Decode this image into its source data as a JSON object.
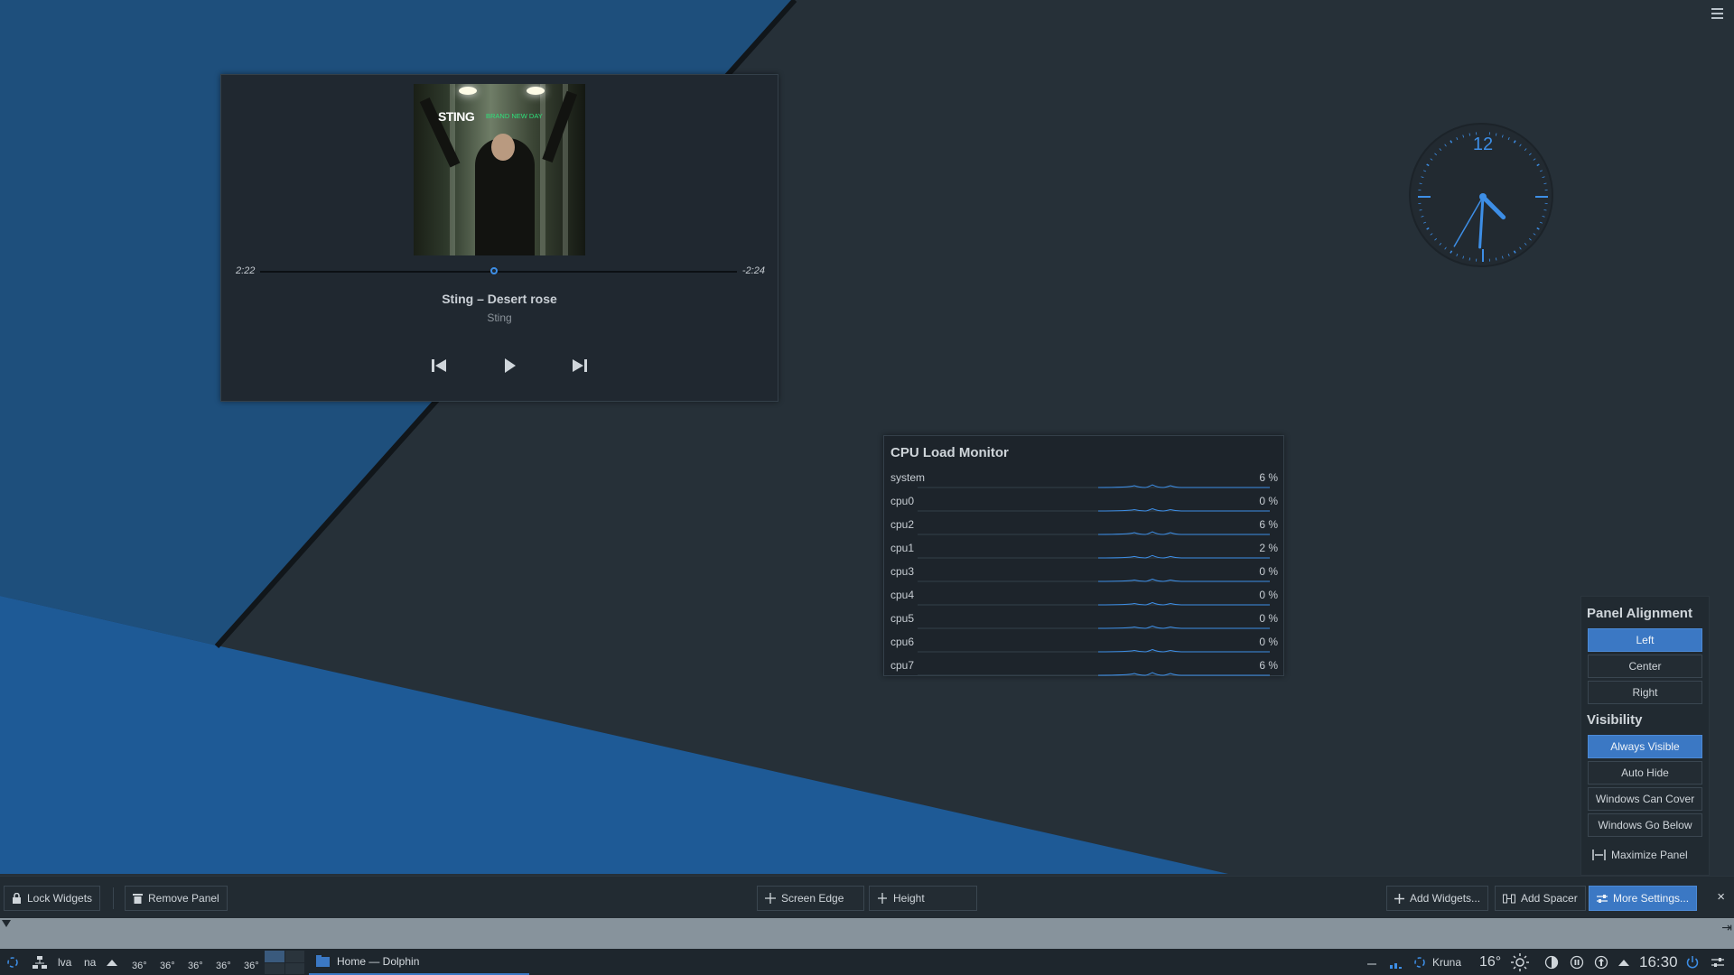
{
  "desktop": {
    "menu_icon": "hamburger-icon"
  },
  "media_player": {
    "album_cover": {
      "title_artist": "STING",
      "title_album": "BRAND NEW DAY"
    },
    "time_elapsed": "2:22",
    "time_remaining": "-2:24",
    "progress": 0.49,
    "track_title": "Sting – Desert rose",
    "track_artist": "Sting",
    "controls": {
      "previous": "skip-previous-icon",
      "play": "play-icon",
      "next": "skip-next-icon"
    }
  },
  "clock": {
    "label_12": "12",
    "hour": 4,
    "minute": 30,
    "second": 35,
    "accent_color": "#3d8ee6"
  },
  "cpu_monitor": {
    "title": "CPU Load Monitor",
    "rows": [
      {
        "name": "system",
        "value": "6 %"
      },
      {
        "name": "cpu0",
        "value": "0 %"
      },
      {
        "name": "cpu2",
        "value": "6 %"
      },
      {
        "name": "cpu1",
        "value": "2 %"
      },
      {
        "name": "cpu3",
        "value": "0 %"
      },
      {
        "name": "cpu4",
        "value": "0 %"
      },
      {
        "name": "cpu5",
        "value": "0 %"
      },
      {
        "name": "cpu6",
        "value": "0 %"
      },
      {
        "name": "cpu7",
        "value": "6 %"
      }
    ],
    "graph_color": "#3d8ee6"
  },
  "panel_settings": {
    "alignment_title": "Panel Alignment",
    "alignment_options": [
      "Left",
      "Center",
      "Right"
    ],
    "alignment_selected": "Left",
    "visibility_title": "Visibility",
    "visibility_options": [
      "Always Visible",
      "Auto Hide",
      "Windows Can Cover",
      "Windows Go Below"
    ],
    "visibility_selected": "Always Visible",
    "maximize_label": "Maximize Panel"
  },
  "edit_toolbar": {
    "lock_widgets": "Lock Widgets",
    "remove_panel": "Remove Panel",
    "screen_edge": "Screen Edge",
    "height": "Height",
    "add_widgets": "Add Widgets...",
    "add_spacer": "Add Spacer",
    "more_settings": "More Settings...",
    "close": "×"
  },
  "taskbar": {
    "keyboard_layouts": [
      "lva",
      "na"
    ],
    "temperatures": [
      "36°",
      "36°",
      "36°",
      "36°",
      "36°"
    ],
    "task_title": "Home — Dolphin",
    "weather_location": "Kruna",
    "weather_temp": "16°",
    "time": "16:30"
  },
  "colors": {
    "accent": "#3b78c4",
    "wallpaper_blue": "#1e5a96",
    "wallpaper_dark": "#263038"
  }
}
